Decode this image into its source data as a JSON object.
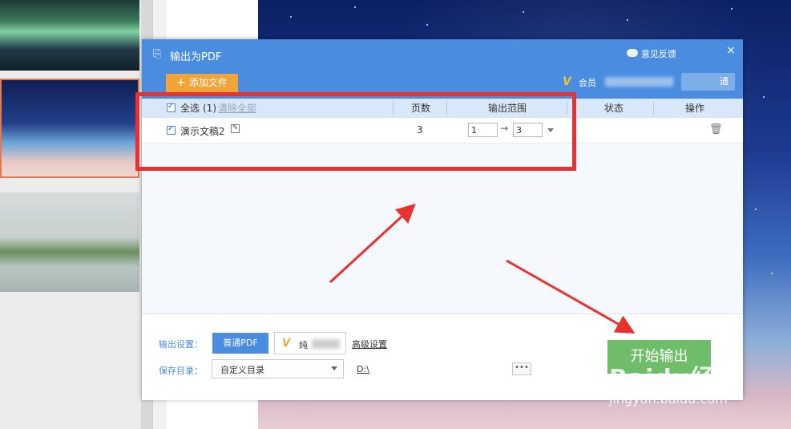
{
  "dialog": {
    "title": "输出为PDF",
    "feedback": "意见反馈",
    "close": "×",
    "add_file": "添加文件",
    "vip_text": "会员",
    "open_btn": "通"
  },
  "table": {
    "headers": {
      "select_all": "全选",
      "count": "(1)",
      "clear_all": "清除全部",
      "pages": "页数",
      "range": "输出范围",
      "status": "状态",
      "action": "操作"
    },
    "rows": [
      {
        "name": "演示文稿2",
        "pages": "3",
        "range_from": "1",
        "range_to": "3"
      }
    ]
  },
  "bottom": {
    "output_settings_label": "输出设置：",
    "normal_pdf": "普通PDF",
    "pure_pdf": "纯",
    "advanced": "高级设置",
    "save_dir_label": "保存目录：",
    "save_dir_value": "自定义目录",
    "path": "D:\\",
    "more": "•••",
    "start": "开始输出"
  },
  "watermark": {
    "line1": "Baidu经验",
    "line2": "jingyan.baidu.com"
  },
  "colors": {
    "titlebar": "#4a8de0",
    "add_button": "#f3a436",
    "start_button": "#6fbd6b",
    "annotation_red": "#e8322f"
  }
}
